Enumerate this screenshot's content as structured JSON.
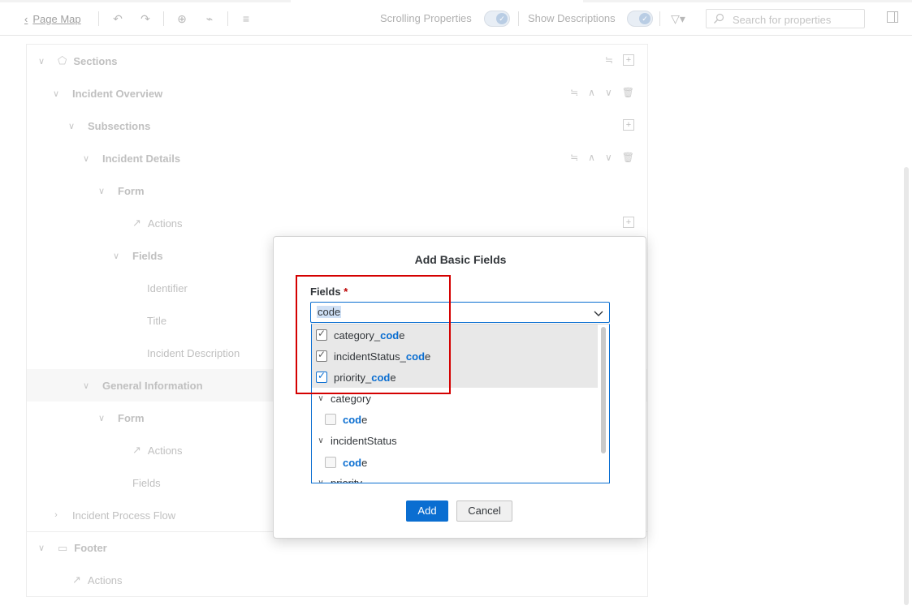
{
  "toolbar": {
    "back_label": "Page Map",
    "scrolling_properties_label": "Scrolling Properties",
    "show_descriptions_label": "Show Descriptions",
    "search_placeholder": "Search for properties"
  },
  "outline": {
    "sections_label": "Sections",
    "incident_overview_label": "Incident Overview",
    "subsections_label": "Subsections",
    "incident_details_label": "Incident Details",
    "form_label": "Form",
    "actions_label": "Actions",
    "fields_label": "Fields",
    "identifier_label": "Identifier",
    "title_label": "Title",
    "incident_description_label": "Incident Description",
    "general_information_label": "General Information",
    "form2_label": "Form",
    "actions2_label": "Actions",
    "fields2_label": "Fields",
    "incident_process_flow_label": "Incident Process Flow",
    "footer_label": "Footer",
    "footer_actions_label": "Actions"
  },
  "dialog": {
    "title": "Add Basic Fields",
    "fields_label": "Fields",
    "required_marker": "*",
    "input_value": "code",
    "items": [
      {
        "pre": "category_",
        "hl": "cod",
        "post": "e"
      },
      {
        "pre": "incidentStatus_",
        "hl": "cod",
        "post": "e"
      },
      {
        "pre": "priority_",
        "hl": "cod",
        "post": "e"
      }
    ],
    "group_category": "category",
    "group_incident_status": "incidentStatus",
    "group_priority": "priority",
    "sub_code_hl": "cod",
    "sub_code_post": "e",
    "add_label": "Add",
    "cancel_label": "Cancel"
  }
}
